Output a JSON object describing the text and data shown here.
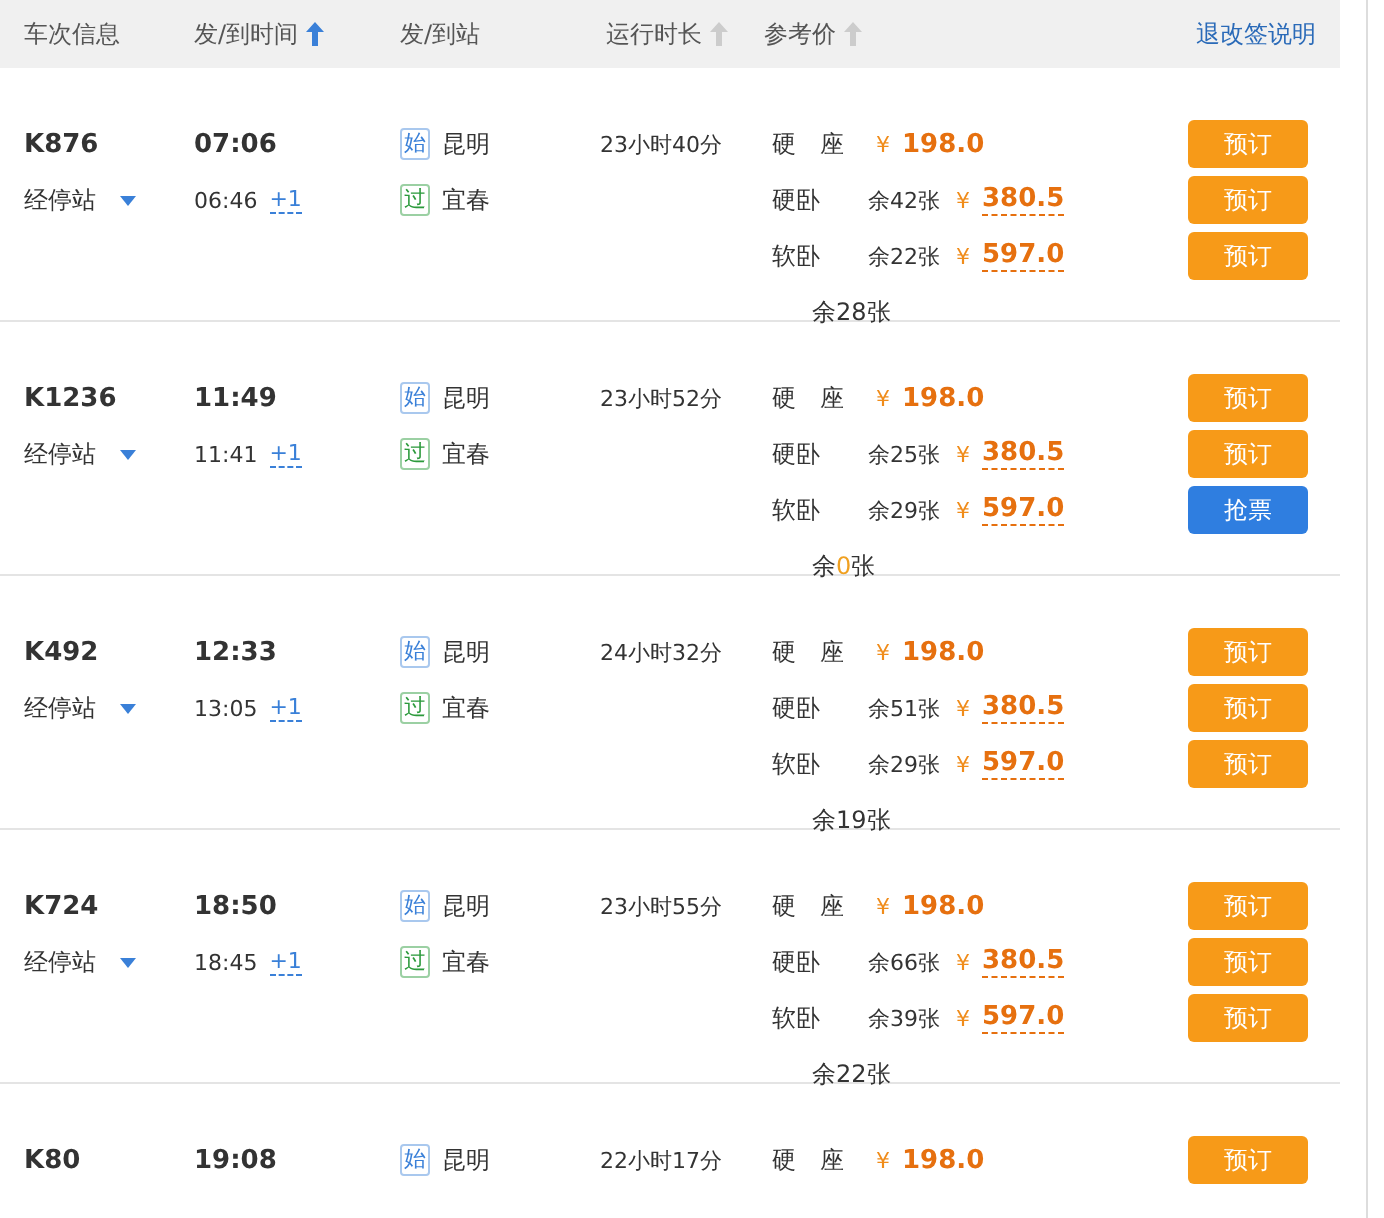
{
  "header": {
    "columns": [
      {
        "label": "车次信息"
      },
      {
        "label": "发/到时间",
        "sorted": true
      },
      {
        "label": "发/到站"
      },
      {
        "label": "运行时长",
        "sorted": false
      },
      {
        "label": "参考价",
        "sorted": false
      }
    ],
    "link": "退改签说明"
  },
  "trains": [
    {
      "number": "K876",
      "stops": "经停站",
      "depart": "07:06",
      "arrive": "06:46",
      "day_offset": "+1",
      "from": {
        "tag": "始",
        "kind": "start",
        "name": "昆明"
      },
      "to": {
        "tag": "过",
        "kind": "pass",
        "name": "宜春"
      },
      "duration": "23小时40分",
      "seats": [
        {
          "name": "硬　座",
          "currency": "¥",
          "price": "198.0",
          "dashed": false,
          "button": {
            "label": "预订",
            "kind": "book"
          }
        },
        {
          "name": "硬卧",
          "remaining": "余42张",
          "currency": "¥",
          "price": "380.5",
          "dashed": true,
          "button": {
            "label": "预订",
            "kind": "book"
          }
        },
        {
          "name": "软卧",
          "remaining": "余22张",
          "currency": "¥",
          "price": "597.0",
          "dashed": true,
          "button": {
            "label": "预订",
            "kind": "book"
          }
        }
      ],
      "note": {
        "before": "余",
        "count": "28",
        "after": "张",
        "highlight": false
      }
    },
    {
      "number": "K1236",
      "stops": "经停站",
      "depart": "11:49",
      "arrive": "11:41",
      "day_offset": "+1",
      "from": {
        "tag": "始",
        "kind": "start",
        "name": "昆明"
      },
      "to": {
        "tag": "过",
        "kind": "pass",
        "name": "宜春"
      },
      "duration": "23小时52分",
      "seats": [
        {
          "name": "硬　座",
          "currency": "¥",
          "price": "198.0",
          "dashed": false,
          "button": {
            "label": "预订",
            "kind": "book"
          }
        },
        {
          "name": "硬卧",
          "remaining": "余25张",
          "currency": "¥",
          "price": "380.5",
          "dashed": true,
          "button": {
            "label": "预订",
            "kind": "book"
          }
        },
        {
          "name": "软卧",
          "remaining": "余29张",
          "currency": "¥",
          "price": "597.0",
          "dashed": true,
          "button": {
            "label": "抢票",
            "kind": "grab"
          }
        }
      ],
      "note": {
        "before": "余",
        "count": "0",
        "after": "张",
        "highlight": true
      }
    },
    {
      "number": "K492",
      "stops": "经停站",
      "depart": "12:33",
      "arrive": "13:05",
      "day_offset": "+1",
      "from": {
        "tag": "始",
        "kind": "start",
        "name": "昆明"
      },
      "to": {
        "tag": "过",
        "kind": "pass",
        "name": "宜春"
      },
      "duration": "24小时32分",
      "seats": [
        {
          "name": "硬　座",
          "currency": "¥",
          "price": "198.0",
          "dashed": false,
          "button": {
            "label": "预订",
            "kind": "book"
          }
        },
        {
          "name": "硬卧",
          "remaining": "余51张",
          "currency": "¥",
          "price": "380.5",
          "dashed": true,
          "button": {
            "label": "预订",
            "kind": "book"
          }
        },
        {
          "name": "软卧",
          "remaining": "余29张",
          "currency": "¥",
          "price": "597.0",
          "dashed": true,
          "button": {
            "label": "预订",
            "kind": "book"
          }
        }
      ],
      "note": {
        "before": "余",
        "count": "19",
        "after": "张",
        "highlight": false
      }
    },
    {
      "number": "K724",
      "stops": "经停站",
      "depart": "18:50",
      "arrive": "18:45",
      "day_offset": "+1",
      "from": {
        "tag": "始",
        "kind": "start",
        "name": "昆明"
      },
      "to": {
        "tag": "过",
        "kind": "pass",
        "name": "宜春"
      },
      "duration": "23小时55分",
      "seats": [
        {
          "name": "硬　座",
          "currency": "¥",
          "price": "198.0",
          "dashed": false,
          "button": {
            "label": "预订",
            "kind": "book"
          }
        },
        {
          "name": "硬卧",
          "remaining": "余66张",
          "currency": "¥",
          "price": "380.5",
          "dashed": true,
          "button": {
            "label": "预订",
            "kind": "book"
          }
        },
        {
          "name": "软卧",
          "remaining": "余39张",
          "currency": "¥",
          "price": "597.0",
          "dashed": true,
          "button": {
            "label": "预订",
            "kind": "book"
          }
        }
      ],
      "note": {
        "before": "余",
        "count": "22",
        "after": "张",
        "highlight": false
      }
    },
    {
      "number": "K80",
      "depart": "19:08",
      "from": {
        "tag": "始",
        "kind": "start",
        "name": "昆明"
      },
      "duration": "22小时17分",
      "seats": [
        {
          "name": "硬　座",
          "currency": "¥",
          "price": "198.0",
          "dashed": false,
          "button": {
            "label": "预订",
            "kind": "book"
          }
        }
      ]
    }
  ]
}
